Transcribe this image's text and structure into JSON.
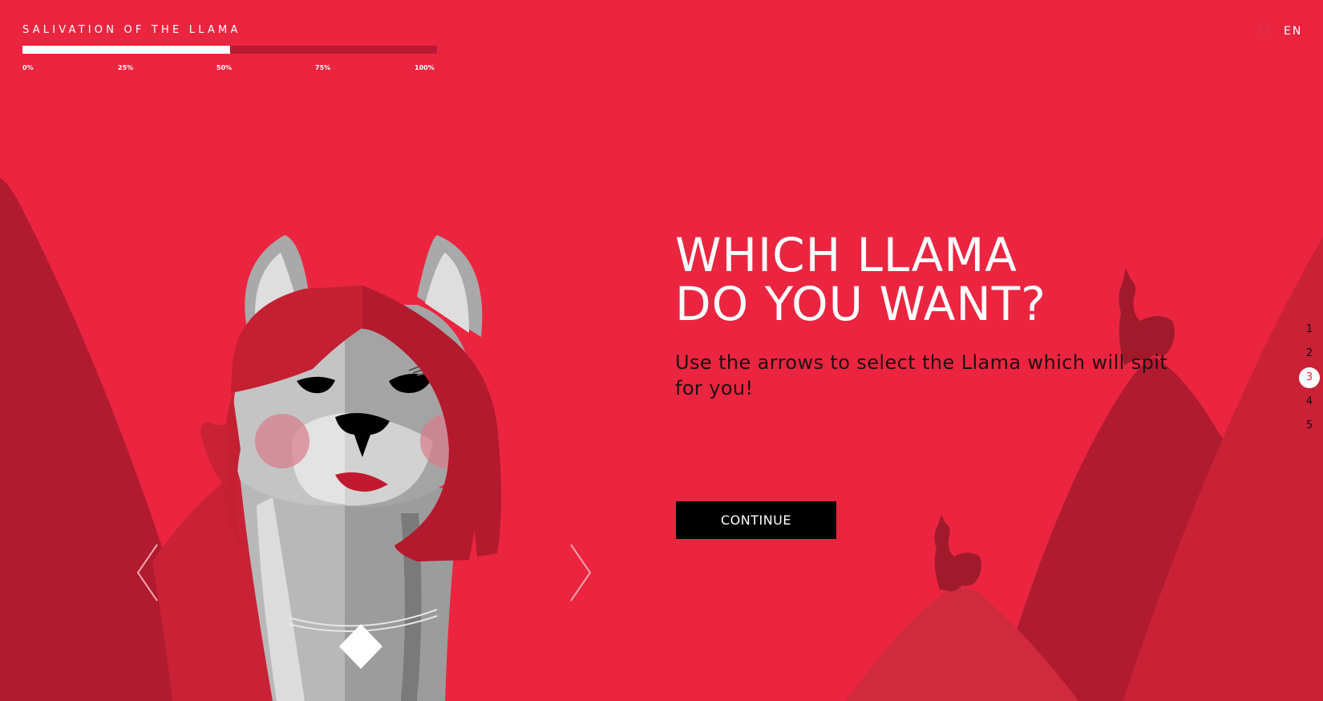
{
  "header": {
    "site_title": "SALIVATION OF THE LLAMA",
    "progress": {
      "value_percent": 50,
      "labels": [
        "0%",
        "25%",
        "50%",
        "75%",
        "100%"
      ]
    }
  },
  "language": {
    "options": [
      "IT",
      "EN"
    ],
    "selected": "EN"
  },
  "main": {
    "headline_line1": "WHICH LLAMA",
    "headline_line2": "DO YOU WANT?",
    "subtitle": "Use the arrows to select the Llama which will spit for you!",
    "continue_label": "CONTINUE"
  },
  "carousel": {
    "prev_icon": "chevron-left-icon",
    "next_icon": "chevron-right-icon"
  },
  "step_nav": {
    "steps": [
      "1",
      "2",
      "3",
      "4",
      "5"
    ],
    "active": "3"
  },
  "colors": {
    "background": "#eb2540",
    "mountain_dark": "#b01b30",
    "mountain_mid": "#c92136",
    "progress_track": "#b71a31",
    "button": "#000000",
    "text_white": "#ffffff",
    "text_dark": "#1e1013"
  }
}
